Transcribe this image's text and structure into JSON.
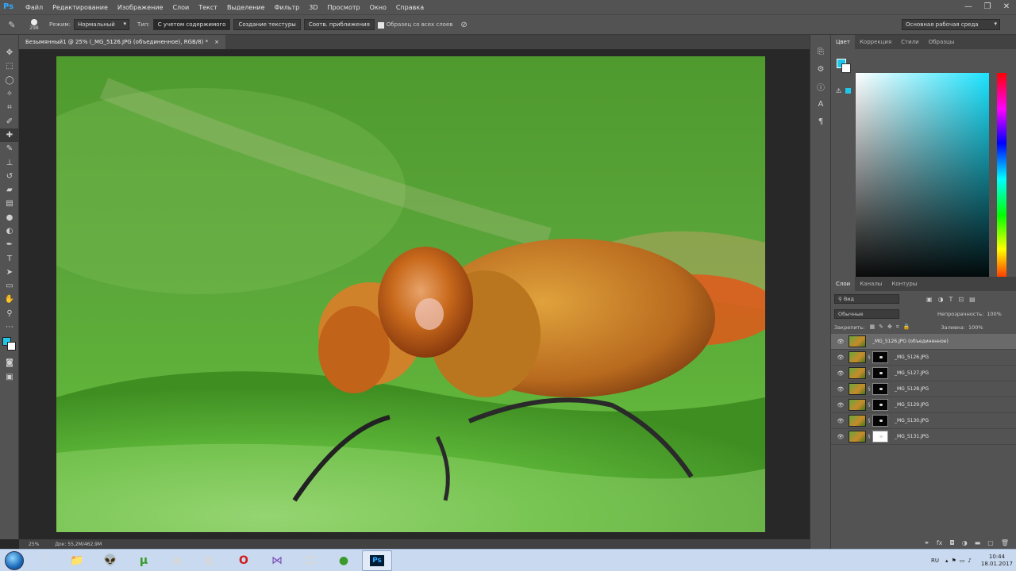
{
  "app": {
    "logo": "Ps"
  },
  "menu": [
    "Файл",
    "Редактирование",
    "Изображение",
    "Слои",
    "Текст",
    "Выделение",
    "Фильтр",
    "3D",
    "Просмотр",
    "Окно",
    "Справка"
  ],
  "options": {
    "brush_size": "298",
    "mode_label": "Режим:",
    "mode_value": "Нормальный",
    "type_label": "Тип:",
    "type_buttons": [
      "С учетом содержимого",
      "Создание текстуры",
      "Соотв. приближения"
    ],
    "sample_all_label": "Образец со всех слоев",
    "workspace": "Основная рабочая среда"
  },
  "document": {
    "tab_title": "Безымянный1 @ 25% (_MG_5126.JPG (объединенное), RGB/8) *",
    "close": "×"
  },
  "status": {
    "zoom": "25%",
    "doc": "Док: 55,2M/462,9M"
  },
  "panels": {
    "color_tabs": [
      "Цвет",
      "Коррекция",
      "Стили",
      "Образцы"
    ],
    "layer_tabs": [
      "Слои",
      "Каналы",
      "Контуры"
    ],
    "filter_kind": "Вид",
    "blend_mode": "Обычные",
    "opacity_label": "Непрозрачность:",
    "opacity_value": "100%",
    "lock_label": "Закрепить:",
    "fill_label": "Заливка:",
    "fill_value": "100%"
  },
  "layers": [
    {
      "name": "_MG_5126.JPG (объединенное)"
    },
    {
      "name": "_MG_5126.JPG"
    },
    {
      "name": "_MG_5127.JPG"
    },
    {
      "name": "_MG_5128.JPG"
    },
    {
      "name": "_MG_5129.JPG"
    },
    {
      "name": "_MG_5130.JPG"
    },
    {
      "name": "_MG_5131.JPG"
    }
  ],
  "colors": {
    "foreground": "#1fc6e8",
    "background": "#ffffff",
    "accent": "#31a8ff"
  },
  "taskbar": {
    "lang": "RU",
    "time": "10:44",
    "date": "18.01.2017"
  }
}
